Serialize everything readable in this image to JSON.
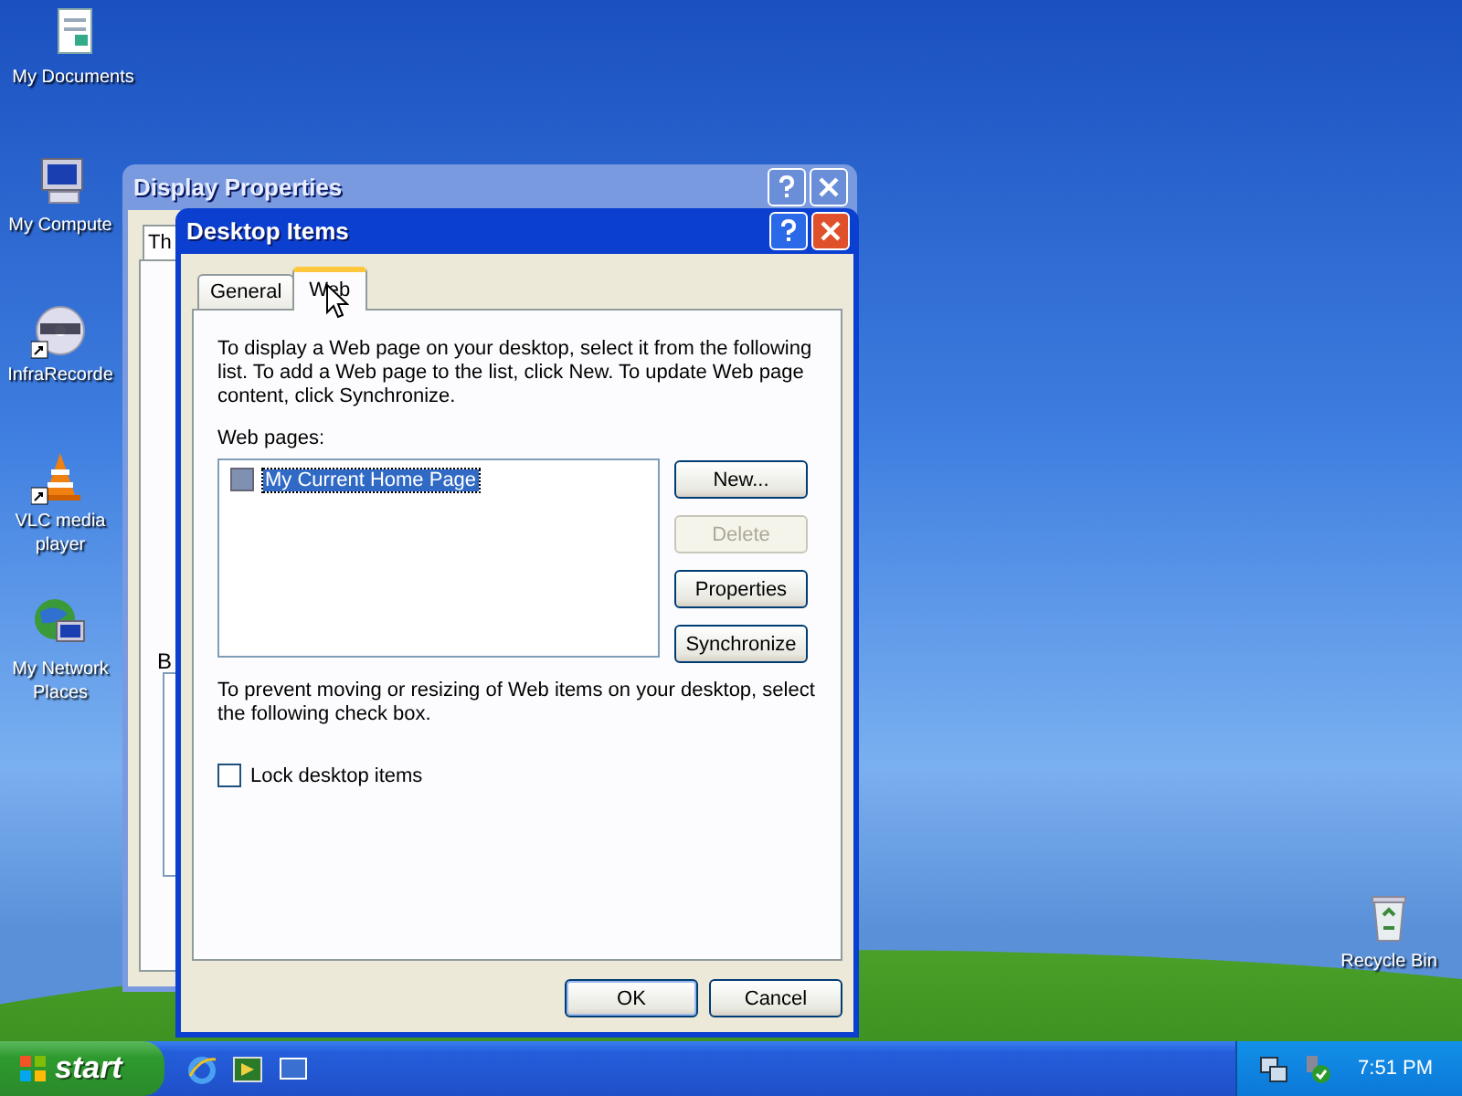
{
  "desktop_icons": [
    {
      "label": "My Documents",
      "kind": "documents"
    },
    {
      "label": "My Compute",
      "kind": "computer"
    },
    {
      "label": "InfraRecorde",
      "kind": "disc",
      "shortcut": true
    },
    {
      "label": "VLC media player",
      "kind": "cone",
      "shortcut": true
    },
    {
      "label": "My Network Places",
      "kind": "network"
    },
    {
      "label": "Recycle Bin",
      "kind": "bin"
    }
  ],
  "back_window": {
    "title": "Display Properties",
    "tab": "Th",
    "label": "B"
  },
  "dialog": {
    "title": "Desktop Items",
    "tabs": [
      {
        "label": "General",
        "selected": false
      },
      {
        "label": "Web",
        "selected": true
      }
    ],
    "description": "To display a Web page on your desktop, select it from the following list. To add a Web page to the list, click New.  To update Web page content, click Synchronize.",
    "list_label": "Web pages:",
    "web_pages": [
      {
        "label": "My Current Home Page",
        "checked": false,
        "selected": true
      }
    ],
    "side_buttons": [
      {
        "label": "New...",
        "disabled": false
      },
      {
        "label": "Delete",
        "disabled": true
      },
      {
        "label": "Properties",
        "disabled": false
      },
      {
        "label": "Synchronize",
        "disabled": false
      }
    ],
    "lock_hint": "To prevent moving or resizing of Web items on your desktop, select the following check box.",
    "lock": {
      "label": "Lock desktop items",
      "checked": false
    },
    "footer_buttons": [
      {
        "label": "OK",
        "default": true
      },
      {
        "label": "Cancel",
        "default": false
      }
    ]
  },
  "taskbar": {
    "start": "start",
    "clock": "7:51 PM"
  }
}
